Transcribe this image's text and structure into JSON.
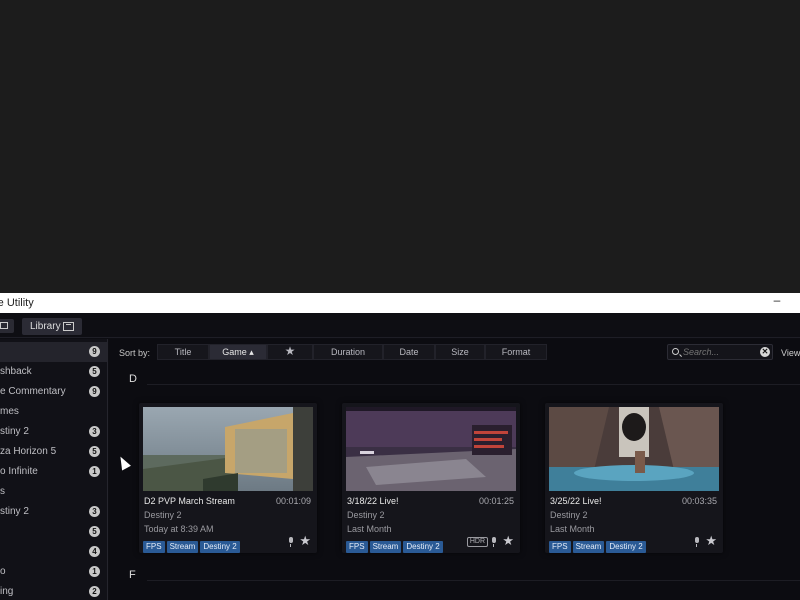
{
  "window": {
    "title": "re Utility",
    "minimize_glyph": "–"
  },
  "tabs": {
    "library_label": "Library"
  },
  "sidebar": {
    "items": [
      {
        "label": "",
        "count": "9",
        "selected": true
      },
      {
        "label": "shback",
        "count": "5"
      },
      {
        "label": "e Commentary",
        "count": "9"
      },
      {
        "label": "mes",
        "count": ""
      },
      {
        "label": "stiny 2",
        "count": "3"
      },
      {
        "label": "za Horizon 5",
        "count": "5"
      },
      {
        "label": "o Infinite",
        "count": "1"
      },
      {
        "label": "s",
        "count": ""
      },
      {
        "label": "stiny 2",
        "count": "3"
      },
      {
        "label": "",
        "count": "5"
      },
      {
        "label": "",
        "count": "4"
      },
      {
        "label": "o",
        "count": "1"
      },
      {
        "label": "ing",
        "count": "2"
      }
    ]
  },
  "sort": {
    "label": "Sort by:",
    "options": [
      {
        "label": "Title"
      },
      {
        "label": "Game ▴",
        "active": true
      },
      {
        "label": "★",
        "icon": "star-icon"
      },
      {
        "label": "Duration"
      },
      {
        "label": "Date"
      },
      {
        "label": "Size"
      },
      {
        "label": "Format"
      }
    ]
  },
  "search": {
    "placeholder": "Search...",
    "clear_glyph": "✕"
  },
  "view": {
    "label": "View:"
  },
  "groups": [
    {
      "letter": "D"
    },
    {
      "letter": "F"
    }
  ],
  "videos": [
    {
      "title": "D2 PVP March Stream",
      "duration": "00:01:09",
      "game": "Destiny 2",
      "date": "Today at 8:39 AM",
      "tags": [
        "FPS",
        "Stream",
        "Destiny 2"
      ],
      "hdr": "",
      "star": "★"
    },
    {
      "title": "3/18/22 Live!",
      "duration": "00:01:25",
      "game": "Destiny 2",
      "date": "Last Month",
      "tags": [
        "FPS",
        "Stream",
        "Destiny 2"
      ],
      "hdr": "HDR",
      "star": "★"
    },
    {
      "title": "3/25/22 Live!",
      "duration": "00:03:35",
      "game": "Destiny 2",
      "date": "Last Month",
      "tags": [
        "FPS",
        "Stream",
        "Destiny 2"
      ],
      "hdr": "",
      "star": "★"
    }
  ],
  "colors": {
    "tag_blue": "#2a5a95",
    "background": "#0c0c11",
    "titlebar": "#ffffff"
  }
}
